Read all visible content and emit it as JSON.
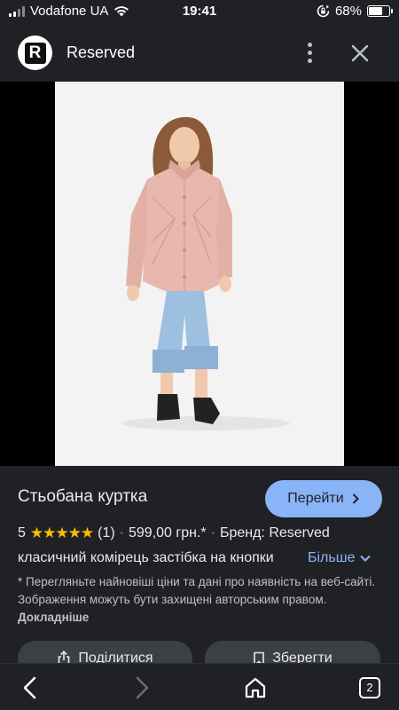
{
  "status_bar": {
    "carrier": "Vodafone UA",
    "time": "19:41",
    "battery": "68%",
    "battery_level": 0.68
  },
  "header": {
    "logo_letter": "R",
    "site_name": "Reserved"
  },
  "product": {
    "title": "Стьобана куртка",
    "visit_label": "Перейти",
    "rating": "5",
    "stars": "★★★★★",
    "review_count": "(1)",
    "price": "599,00 грн.*",
    "brand": "Бренд: Reserved",
    "description": "класичний комірець застібка на кнопки",
    "more_label": "Більше",
    "disclaimer": "* Перегляньте найновіші ціни та дані про наявність на веб-сайті. Зображення можуть бути захищені авторським правом.",
    "details_link": "Докладніше",
    "share_label": "Поділитися",
    "save_label": "Зберегти"
  },
  "nav": {
    "tab_count": "2"
  },
  "colors": {
    "background": "#202124",
    "accent": "#8ab4f8",
    "star": "#fbbc04"
  }
}
